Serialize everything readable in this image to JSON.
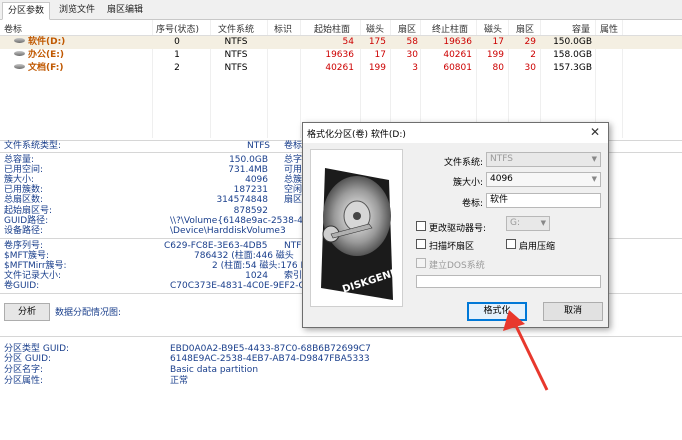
{
  "tabs": [
    "分区参数",
    "浏览文件",
    "扇区编辑"
  ],
  "table": {
    "headers": [
      "卷标",
      "序号(状态)",
      "文件系统",
      "标识",
      "起始柱面",
      "磁头",
      "扇区",
      "终止柱面",
      "磁头",
      "扇区",
      "容量",
      "属性"
    ],
    "rows": [
      {
        "label": "软件(D:)",
        "index": "0",
        "fs": "NTFS",
        "id": "",
        "start_cyl": "54",
        "start_head": "175",
        "start_sec": "58",
        "end_cyl": "19636",
        "end_head": "17",
        "end_sec": "29",
        "size": "150.0GB",
        "attr": ""
      },
      {
        "label": "办公(E:)",
        "index": "1",
        "fs": "NTFS",
        "id": "",
        "start_cyl": "19636",
        "start_head": "17",
        "start_sec": "30",
        "end_cyl": "40261",
        "end_head": "199",
        "end_sec": "2",
        "size": "158.0GB",
        "attr": ""
      },
      {
        "label": "文档(F:)",
        "index": "2",
        "fs": "NTFS",
        "id": "",
        "start_cyl": "40261",
        "start_head": "199",
        "start_sec": "3",
        "end_cyl": "60801",
        "end_head": "80",
        "end_sec": "30",
        "size": "157.3GB",
        "attr": ""
      }
    ]
  },
  "info": {
    "fs_type_label": "文件系统类型:",
    "fs_type_value": "NTFS",
    "fs_type_label2": "卷标",
    "total_cap_label": "总容量:",
    "total_cap_value": "150.0GB",
    "total_cap_label2": "总字",
    "used_label": "已用空间:",
    "used_value": "731.4MB",
    "used_label2": "可用",
    "cluster_size_label": "簇大小:",
    "cluster_size_value": "4096",
    "cluster_size_label2": "总簇",
    "used_clusters_label": "已用簇数:",
    "used_clusters_value": "187231",
    "used_clusters_label2": "空闲",
    "total_sectors_label": "总扇区数:",
    "total_sectors_value": "314574848",
    "total_sectors_label2": "扇区",
    "start_sector_label": "起始扇区号:",
    "start_sector_value": "878592",
    "guid_path_label": "GUID路径:",
    "guid_path_value": "\\\\?\\Volume{6148e9ac-2538-4",
    "device_path_label": "设备路径:",
    "device_path_value": "\\Device\\HarddiskVolume3",
    "serial_label": "卷序列号:",
    "serial_value": "C629-FC8E-3E63-4DB5",
    "serial_label2": "NTF",
    "mft_label": "$MFT簇号:",
    "mft_value": "786432 (柱面:446 磁头",
    "mft_label2": "",
    "mftmirr_label": "$MFTMirr簇号:",
    "mftmirr_value": "2 (柱面:54 磁头:176 I",
    "record_size_label": "文件记录大小:",
    "record_size_value": "1024",
    "record_size_label2": "索引",
    "vol_guid_label": "卷GUID:",
    "vol_guid_value": "C70C373E-4831-4C0E-9EF2-C",
    "analyze_button": "分析",
    "alloc_chart_label": "数据分配情况图:",
    "type_guid_label": "分区类型 GUID:",
    "type_guid_value": "EBD0A0A2-B9E5-4433-87C0-68B6B72699C7",
    "part_guid_label": "分区 GUID:",
    "part_guid_value": "6148E9AC-2538-4EB7-AB74-D9847FBA5333",
    "part_name_label": "分区名字:",
    "part_name_value": "Basic data partition",
    "part_attr_label": "分区属性:",
    "part_attr_value": "正常"
  },
  "dialog": {
    "title": "格式化分区(卷) 软件(D:)",
    "close_glyph": "✕",
    "fs_label": "文件系统:",
    "fs_value": "NTFS",
    "cluster_label": "簇大小:",
    "cluster_value": "4096",
    "volume_label": "卷标:",
    "volume_value": "软件",
    "change_drive_label": "更改驱动器号:",
    "drive_letter_value": "G:",
    "scan_bad_label": "扫描坏扇区",
    "compress_label": "启用压缩",
    "dos_label": "建立DOS系统",
    "format_button": "格式化",
    "cancel_button": "取消",
    "brand_text": "DISKGENIUS"
  },
  "colors": {
    "accent": "#0078d7",
    "arrow": "#e8382d",
    "label_blue": "#1a3f8c",
    "start_red": "#cc0000",
    "row_label": "#c05800"
  }
}
